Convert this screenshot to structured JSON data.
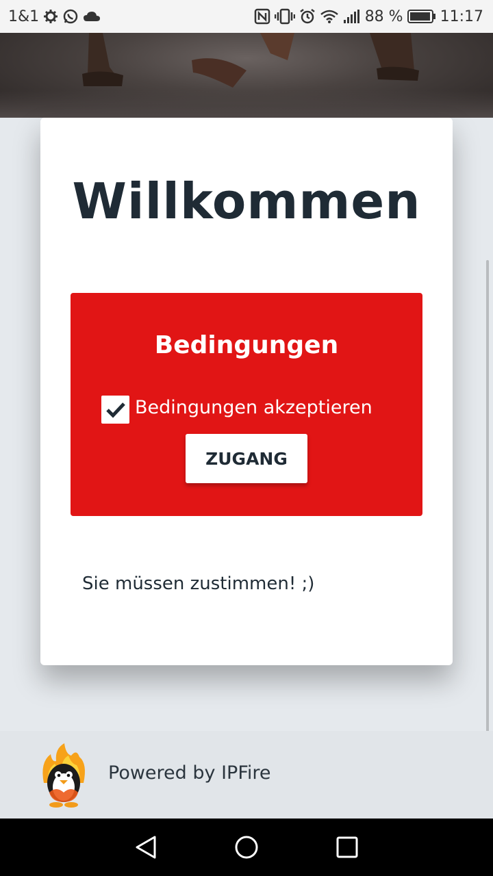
{
  "status_bar": {
    "carrier": "1&1",
    "battery_percent": "88 %",
    "time": "11:17",
    "left_icons": [
      "settings-gear-icon",
      "whatsapp-icon",
      "cloud-icon"
    ],
    "right_icons": [
      "nfc-icon",
      "vibrate-icon",
      "alarm-icon",
      "wifi-icon",
      "signal-icon",
      "battery-icon"
    ]
  },
  "card": {
    "title": "Willkommen",
    "terms": {
      "heading": "Bedingungen",
      "checkbox_label": "Bedingungen akzeptieren",
      "checkbox_checked": true,
      "submit_label": "ZUGANG",
      "accent_color": "#e11515"
    },
    "note": "Sie müssen zustimmen! ;)"
  },
  "footer": {
    "powered_by": "Powered by IPFire",
    "logo_icon": "ipfire-penguin-logo"
  },
  "nav_bar": {
    "buttons": [
      "back-icon",
      "home-icon",
      "recents-icon"
    ]
  }
}
